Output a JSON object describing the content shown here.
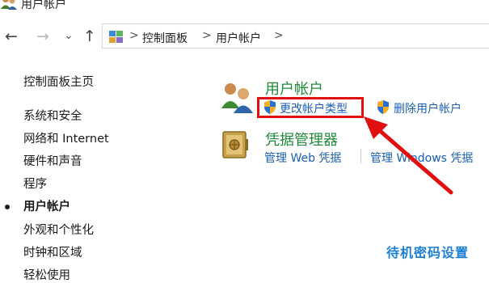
{
  "window": {
    "title": "用户帐户"
  },
  "nav": {
    "back_icon": "arrow-left-icon",
    "forward_icon": "arrow-right-icon",
    "dropdown_icon": "chevron-down-icon",
    "up_icon": "arrow-up-icon"
  },
  "address_bar": {
    "breadcrumbs": [
      "控制面板",
      "用户帐户"
    ],
    "separator": ">"
  },
  "sidebar": {
    "home": "控制面板主页",
    "items": [
      {
        "label": "系统和安全",
        "active": false
      },
      {
        "label": "网络和 Internet",
        "active": false
      },
      {
        "label": "硬件和声音",
        "active": false
      },
      {
        "label": "程序",
        "active": false
      },
      {
        "label": "用户帐户",
        "active": true
      },
      {
        "label": "外观和个性化",
        "active": false
      },
      {
        "label": "时钟和区域",
        "active": false
      },
      {
        "label": "轻松使用",
        "active": false
      }
    ]
  },
  "main": {
    "categories": [
      {
        "title": "用户帐户",
        "icon": "users-icon",
        "links": [
          {
            "label": "更改帐户类型",
            "icon": "uac-shield-icon",
            "highlighted": true
          },
          {
            "label": "删除用户帐户",
            "icon": "uac-shield-icon",
            "highlighted": false
          }
        ]
      },
      {
        "title": "凭据管理器",
        "icon": "credential-vault-icon",
        "links": [
          {
            "label": "管理 Web 凭据"
          },
          {
            "label": "管理 Windows 凭据"
          }
        ]
      }
    ]
  },
  "annotation": {
    "highlight_color": "#e01010",
    "arrow_color": "#e01010"
  },
  "watermark": {
    "text": "待机密码设置",
    "color": "#1c7fd6"
  },
  "colors": {
    "category_title": "#1f8a3a",
    "link": "#1a5fb4"
  }
}
